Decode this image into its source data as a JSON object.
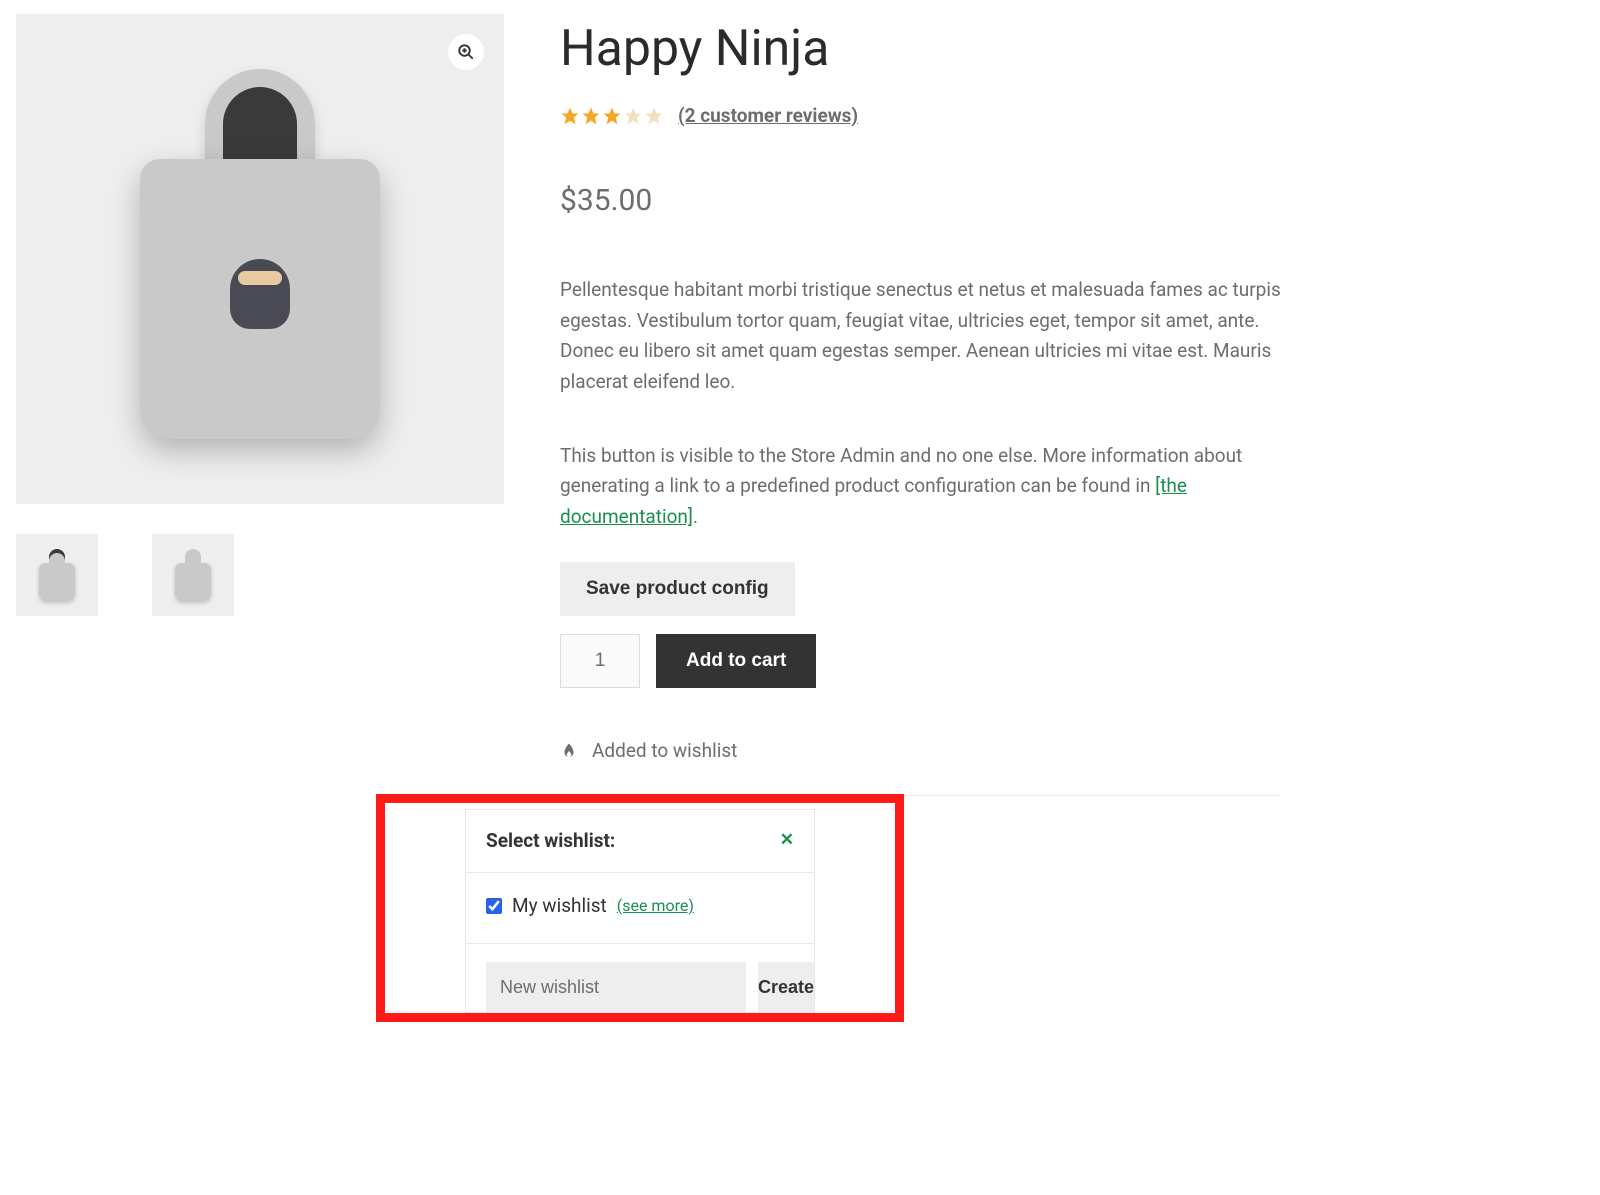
{
  "product": {
    "title": "Happy Ninja",
    "price": "$35.00",
    "rating_full": 3,
    "rating_empty": 2,
    "reviews_link": "(2 customer reviews)",
    "description": "Pellentesque habitant morbi tristique senectus et netus et malesuada fames ac turpis egestas. Vestibulum tortor quam, feugiat vitae, ultricies eget, tempor sit amet, ante. Donec eu libero sit amet quam egestas semper. Aenean ultricies mi vitae est. Mauris placerat eleifend leo.",
    "admin_note_pre": "This button is visible to the Store Admin and no one else. More information about generating a link to a predefined product configuration can be found in ",
    "doc_link": "[the documentation]",
    "admin_note_post": ".",
    "save_config_label": "Save product config",
    "quantity": "1",
    "add_to_cart_label": "Add to cart",
    "wishlist_status": "Added to wishlist"
  },
  "select_panel": {
    "title": "Select wishlist:",
    "list_name": "My wishlist",
    "see_more": "(see more)",
    "new_placeholder": "New wishlist",
    "create_label": "Create"
  },
  "colors": {
    "accent_green": "#1a8f4f",
    "star_fill": "#f5a623",
    "highlight_border": "#ff1a1a"
  }
}
